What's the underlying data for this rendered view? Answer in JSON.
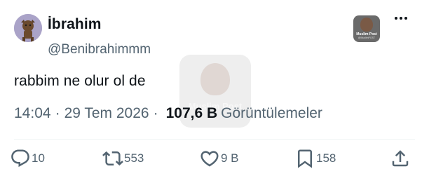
{
  "author": {
    "name": "İbrahim",
    "handle": "@Benibrahimmm"
  },
  "badge": {
    "label": "Muslim Post",
    "sub": "@MuslimPOST"
  },
  "watermark": {
    "text": "Muslim Post"
  },
  "tweet": {
    "text": "rabbim ne olur ol de"
  },
  "meta": {
    "time": "14:04",
    "separator": "·",
    "date": "29 Tem 2026",
    "views_count": "107,6 B",
    "views_label": "Görüntülemeler"
  },
  "actions": {
    "reply_count": "10",
    "retweet_count": "553",
    "like_count": "9 B",
    "bookmark_count": "158"
  },
  "icons": {
    "reply": "reply-icon",
    "retweet": "retweet-icon",
    "like": "heart-icon",
    "bookmark": "bookmark-icon",
    "share": "share-icon",
    "more": "more-dots-icon"
  },
  "colors": {
    "text": "#0f1419",
    "secondary": "#536471"
  }
}
